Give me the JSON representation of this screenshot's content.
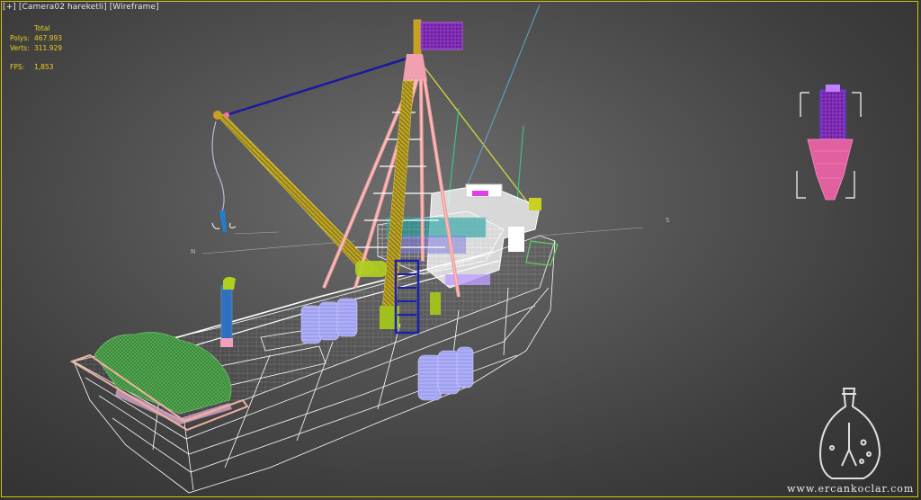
{
  "viewport": {
    "label_parts": [
      "[+]",
      "[Camera02 hareketli]",
      "[Wireframe]"
    ]
  },
  "stats": {
    "header": "Total",
    "polys_label": "Polys:",
    "polys_value": "467.993",
    "verts_label": "Verts:",
    "verts_value": "311.929",
    "fps_label": "FPS:",
    "fps_value": "1,853"
  },
  "compass": {
    "north": "N",
    "south": "S"
  },
  "watermark": {
    "text": "www.ercankoclar.com"
  },
  "colors": {
    "viewport_border": "#d8c200",
    "stats_text": "#e6d21a",
    "hull_wire": "#ffffff",
    "mast_pink": "#f0a0a0",
    "boom_olive": "#b8a020",
    "flag_purple": "#9020c0",
    "buoy_lavender": "#a8a0ff",
    "net_green": "#40a040"
  }
}
